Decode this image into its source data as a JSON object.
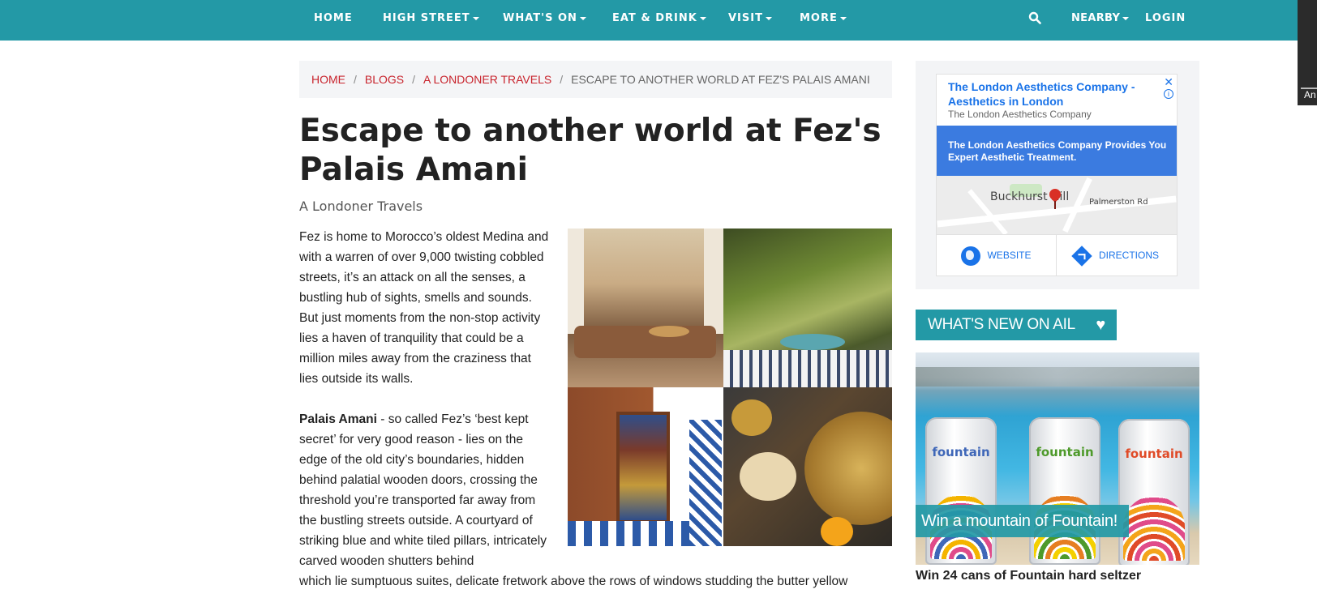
{
  "nav": {
    "home": "HOME",
    "high_street": "HIGH STREET",
    "whats_on": "WHAT'S ON",
    "eat_drink": "EAT & DRINK",
    "visit": "VISIT",
    "more": "MORE",
    "search_icon": "search-icon",
    "nearby": "NEARBY",
    "login": "LOGIN",
    "color": "#2399a6"
  },
  "side_strip_text": "An",
  "breadcrumb": {
    "home": "HOME",
    "blogs": "BLOGS",
    "londoner_travels": "A LONDONER TRAVELS",
    "current": "ESCAPE TO ANOTHER WORLD AT FEZ'S PALAIS AMANI",
    "separator": "/",
    "link_color": "#c8232c"
  },
  "article": {
    "title": "Escape to another world at Fez's Palais Amani",
    "subtitle": "A Londoner Travels",
    "paragraph1": "Fez is home to Morocco’s oldest Medina and with a warren of over 9,000 twisting cobbled streets, it’s an attack on all the senses, a bustling hub of sights, smells and sounds. But just moments from the non-stop activity lies a haven of tranquility that could be a million miles away from the craziness that lies outside its walls.",
    "paragraph2_bold": "Palais Amani",
    "paragraph2_rest": " - so called Fez’s ‘best kept secret’ for very good reason - lies on the edge of the old city’s boundaries, hidden behind palatial wooden doors, crossing the threshold you’re transported far away from the bustling streets outside. A courtyard of striking blue and white tiled pillars, intricately carved wooden shutters behind",
    "paragraph3": "which lie sumptuous suites, delicate fretwork above the rows of windows studding the butter yellow"
  },
  "ad": {
    "title": "The London Aesthetics Company - Aesthetics in London",
    "company": "The London Aesthetics Company",
    "close": "✕",
    "info": "i",
    "blurb": "The London Aesthetics Company Provides You Expert Aesthetic Treatment.",
    "map_label_area": "Buckhurst Hill",
    "map_label_road": "Palmerston Rd",
    "website": "WEBSITE",
    "directions": "DIRECTIONS",
    "link_color": "#1a73e8"
  },
  "whats_new": {
    "label": "WHAT'S NEW ON AIL",
    "heart_icon": "heart-icon",
    "promo_caption": "Win a mountain of Fountain!",
    "promo_title": "Win 24 cans of Fountain hard seltzer",
    "can_brand": "fountain"
  }
}
